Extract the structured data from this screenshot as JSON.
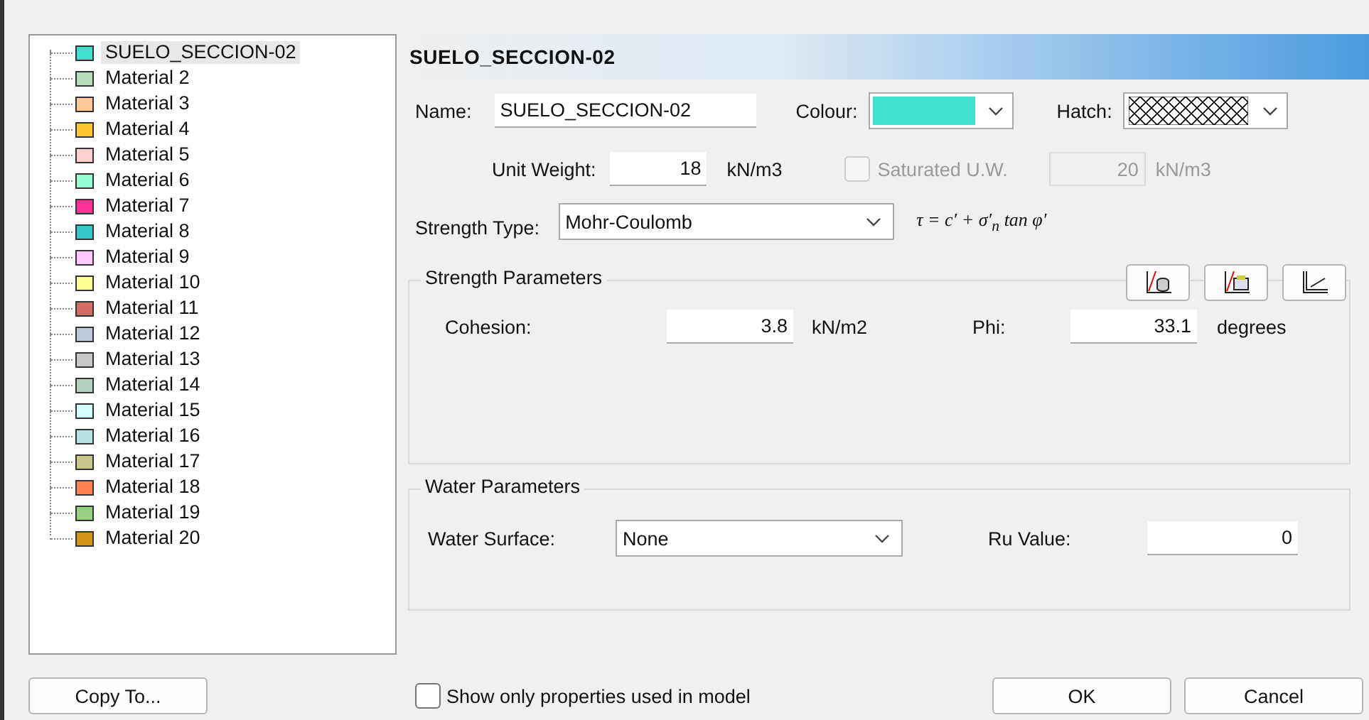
{
  "materials": [
    {
      "name": "SUELO_SECCION-02",
      "color": "#40e0d0",
      "selected": true
    },
    {
      "name": "Material 2",
      "color": "#b8dcb8",
      "selected": false
    },
    {
      "name": "Material 3",
      "color": "#ffc896",
      "selected": false
    },
    {
      "name": "Material 4",
      "color": "#ffc832",
      "selected": false
    },
    {
      "name": "Material 5",
      "color": "#ffd0d0",
      "selected": false
    },
    {
      "name": "Material 6",
      "color": "#96ffd2",
      "selected": false
    },
    {
      "name": "Material 7",
      "color": "#ff3296",
      "selected": false
    },
    {
      "name": "Material 8",
      "color": "#32c8c8",
      "selected": false
    },
    {
      "name": "Material 9",
      "color": "#ffc8ff",
      "selected": false
    },
    {
      "name": "Material 10",
      "color": "#ffff96",
      "selected": false
    },
    {
      "name": "Material 11",
      "color": "#d26e64",
      "selected": false
    },
    {
      "name": "Material 12",
      "color": "#c0c8dc",
      "selected": false
    },
    {
      "name": "Material 13",
      "color": "#c8c8c8",
      "selected": false
    },
    {
      "name": "Material 14",
      "color": "#b4d2be",
      "selected": false
    },
    {
      "name": "Material 15",
      "color": "#d2ffff",
      "selected": false
    },
    {
      "name": "Material 16",
      "color": "#b4e1e1",
      "selected": false
    },
    {
      "name": "Material 17",
      "color": "#c8c88c",
      "selected": false
    },
    {
      "name": "Material 18",
      "color": "#ff8050",
      "selected": false
    },
    {
      "name": "Material 19",
      "color": "#96d282",
      "selected": false
    },
    {
      "name": "Material 20",
      "color": "#d29614",
      "selected": false
    }
  ],
  "header": {
    "title": "SUELO_SECCION-02"
  },
  "name": {
    "label": "Name:",
    "value": "SUELO_SECCION-02"
  },
  "colour": {
    "label": "Colour:",
    "color": "#40e0d0"
  },
  "hatch": {
    "label": "Hatch:"
  },
  "unit_weight": {
    "label": "Unit Weight:",
    "value": "18",
    "unit": "kN/m3"
  },
  "saturated": {
    "label": "Saturated U.W.",
    "checked": false,
    "disabled": true,
    "value": "20",
    "unit": "kN/m3"
  },
  "strength_type": {
    "label": "Strength Type:",
    "value": "Mohr-Coulomb",
    "formula": "τ = c′ + σ′$_{n}$ tan φ′"
  },
  "strength_parameters": {
    "title": "Strength Parameters",
    "cohesion": {
      "label": "Cohesion:",
      "value": "3.8",
      "unit": "kN/m2"
    },
    "phi": {
      "label": "Phi:",
      "value": "33.1",
      "unit": "degrees"
    }
  },
  "water_parameters": {
    "title": "Water Parameters",
    "surface": {
      "label": "Water Surface:",
      "value": "None"
    },
    "ru": {
      "label": "Ru Value:",
      "value": "0"
    }
  },
  "footer": {
    "copy_to": "Copy To...",
    "show_only": {
      "label": "Show only properties used in model",
      "checked": false
    },
    "buttons": [
      "OK",
      "Cancel"
    ]
  }
}
